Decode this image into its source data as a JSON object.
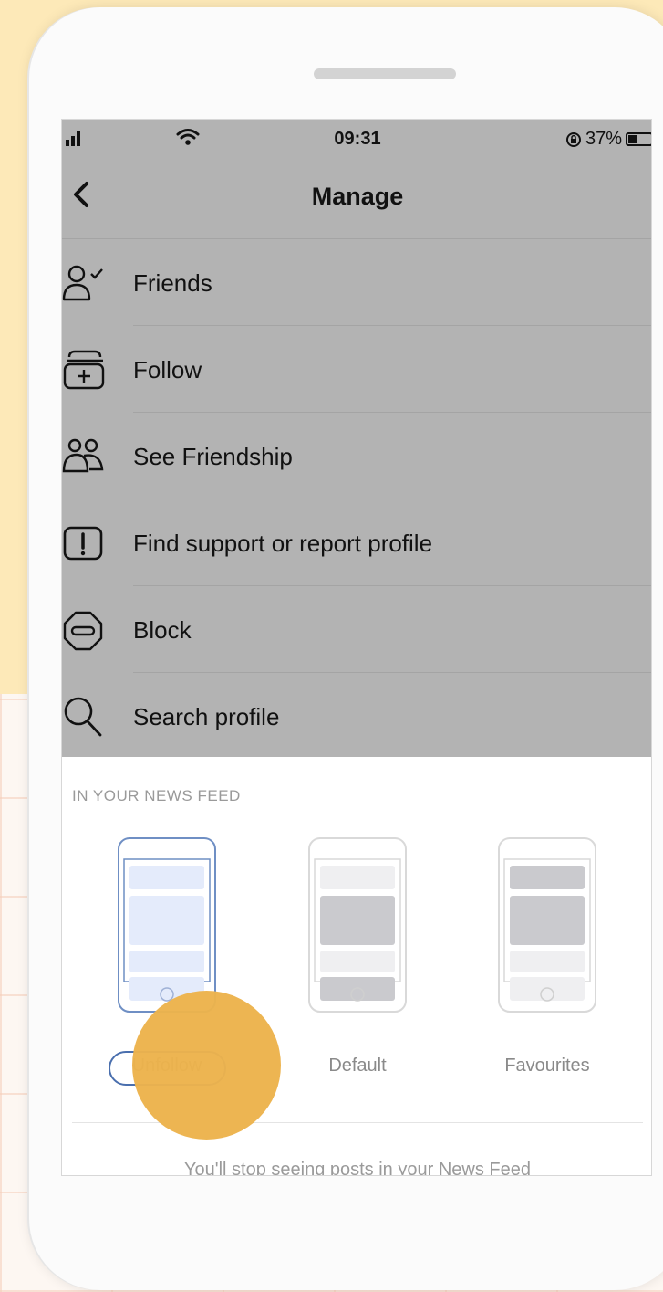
{
  "status_bar": {
    "time": "09:31",
    "battery": "37%"
  },
  "header": {
    "title": "Manage"
  },
  "menu": {
    "items": [
      {
        "label": "Friends",
        "icon": "friends-icon"
      },
      {
        "label": "Follow",
        "icon": "follow-icon"
      },
      {
        "label": "See Friendship",
        "icon": "see-friendship-icon"
      },
      {
        "label": "Find support or report profile",
        "icon": "report-icon"
      },
      {
        "label": "Block",
        "icon": "block-icon"
      },
      {
        "label": "Search profile",
        "icon": "search-icon"
      }
    ]
  },
  "news_feed": {
    "section_title": "IN YOUR NEWS FEED",
    "options": [
      {
        "label": "Unfollow",
        "selected": true
      },
      {
        "label": "Default",
        "selected": false
      },
      {
        "label": "Favourites",
        "selected": false
      }
    ],
    "note": "You'll stop seeing posts in your News Feed"
  },
  "colors": {
    "overlay": "#b3b3b3",
    "accent": "#4a6fae",
    "tap_highlight": "#ecb34c",
    "background": "#fde9b8"
  }
}
